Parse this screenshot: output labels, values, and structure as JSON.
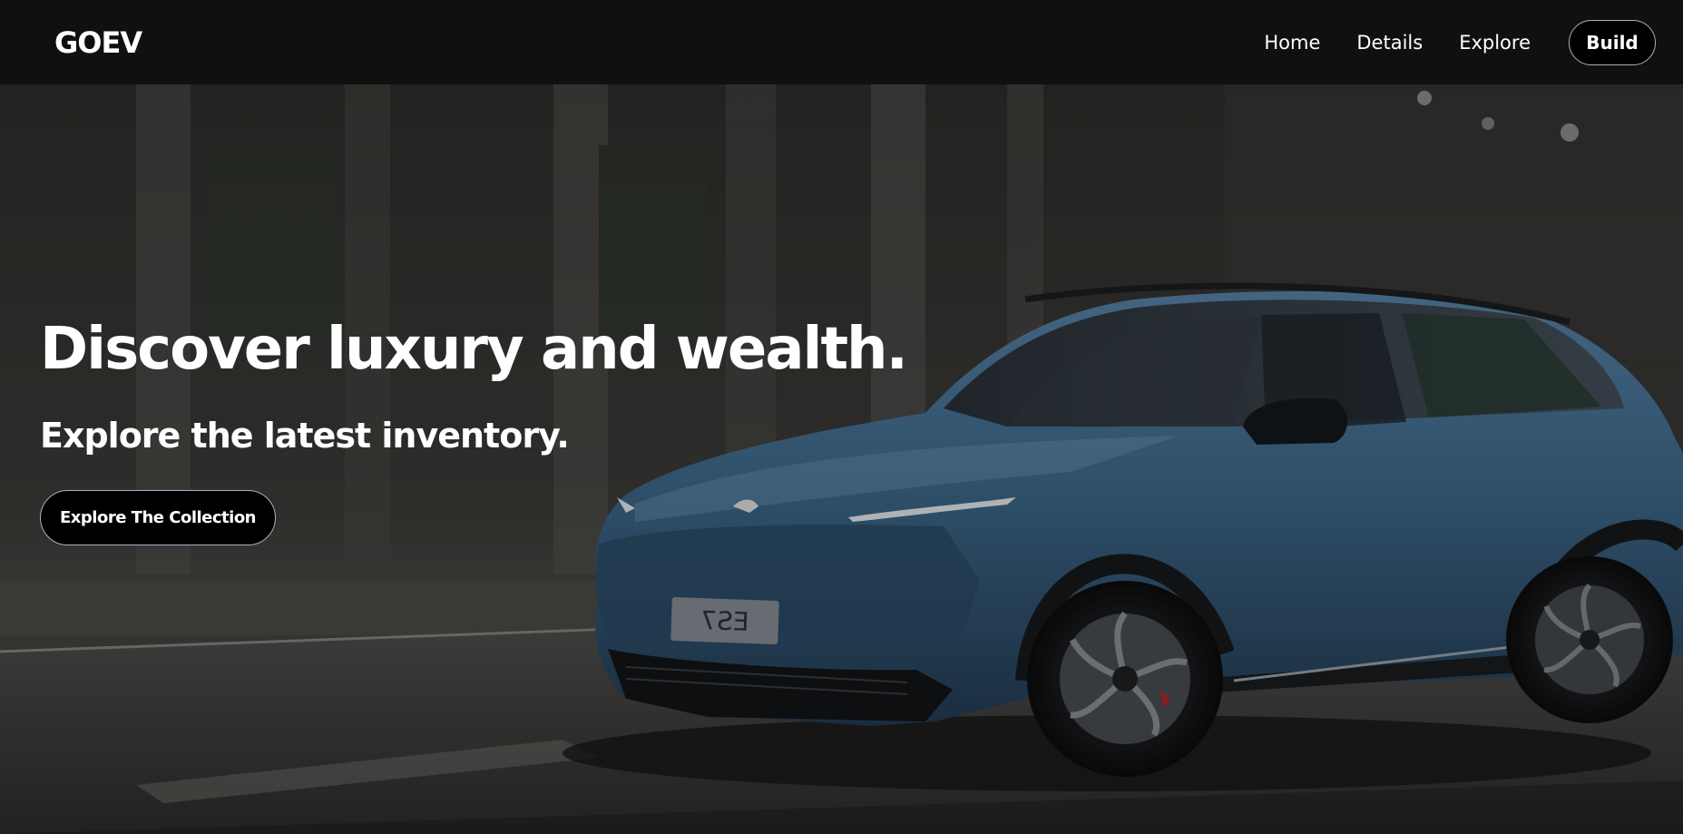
{
  "navbar": {
    "logo": "GOEV",
    "links": [
      "Home",
      "Details",
      "Explore"
    ],
    "build_label": "Build"
  },
  "hero": {
    "headline": "Discover luxury and wealth.",
    "subheadline": "Explore the latest inventory.",
    "cta_label": "Explore The Collection",
    "plate_text": "ES7",
    "image_description_icon": "car-photo"
  },
  "colors": {
    "nav_bg": "#101010",
    "button_bg": "#000000",
    "button_border": "#9fb4c6",
    "car_blue": "#3f6b8e"
  }
}
